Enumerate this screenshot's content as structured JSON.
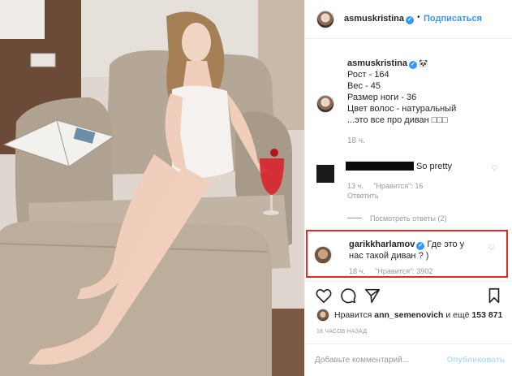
{
  "post": {
    "username": "asmuskristina",
    "follow_label": "Подписаться",
    "separator": "•"
  },
  "caption": {
    "username": "asmuskristina",
    "sticker": "🐼",
    "lines": [
      "Рост - 164",
      "Вес - 45",
      "Размер ноги - 36",
      "Цвет волос - натуральный",
      "...это все про диван □□□"
    ],
    "time": "18 ч."
  },
  "comment1": {
    "text": "So pretty",
    "time": "13 ч.",
    "likes": "\"Нравится\": 16",
    "reply": "Ответить"
  },
  "show_replies": "Посмотреть ответы (2)",
  "comment2": {
    "username": "garikkharlamov",
    "text": "Где это у нас такой диван ? )",
    "time": "18 ч.",
    "likes": "\"Нравится\": 3902"
  },
  "likes": {
    "prefix": "Нравится",
    "user": "ann_semenovich",
    "middle": "и ещё",
    "count": "153 871"
  },
  "posted_ago": "18 ЧАСОВ НАЗАД",
  "comment_box": {
    "placeholder": "Добавьте комментарий...",
    "post_label": "Опубликовать"
  },
  "colors": {
    "accent": "#3897f0",
    "highlight_border": "#e32a27"
  },
  "icons": [
    "heart-icon",
    "comment-icon",
    "share-icon",
    "bookmark-icon",
    "verified-badge-icon"
  ]
}
